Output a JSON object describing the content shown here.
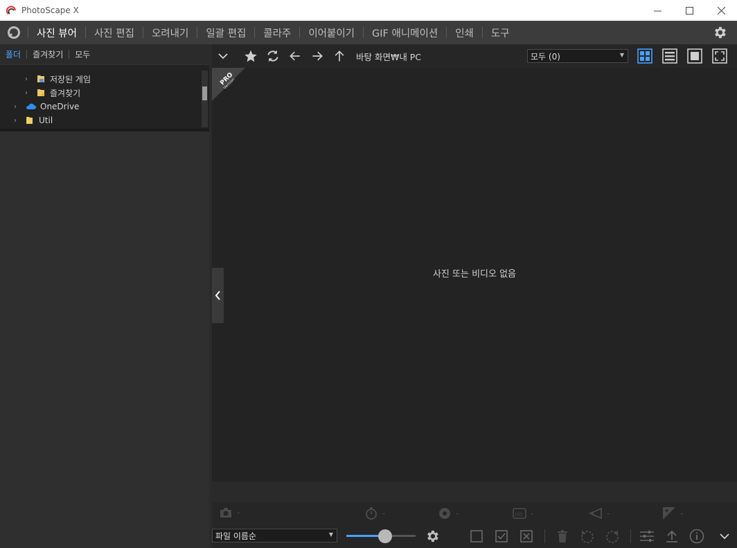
{
  "window": {
    "title": "PhotoScape X",
    "minimize_glyph": "—",
    "maximize_glyph": "☐",
    "close_glyph": "✕"
  },
  "menu": {
    "items": [
      {
        "label": "사진 뷰어",
        "active": true
      },
      {
        "label": "사진 편집",
        "active": false
      },
      {
        "label": "오려내기",
        "active": false
      },
      {
        "label": "일괄 편집",
        "active": false
      },
      {
        "label": "콜라주",
        "active": false
      },
      {
        "label": "이어붙이기",
        "active": false
      },
      {
        "label": "GIF 애니메이션",
        "active": false
      },
      {
        "label": "인쇄",
        "active": false
      },
      {
        "label": "도구",
        "active": false
      }
    ]
  },
  "left_tabs": {
    "folder": "폴더",
    "favorites": "즐겨찾기",
    "all": "모두"
  },
  "tree": {
    "items": [
      {
        "label": "저장된 게임",
        "icon": "saved-games-icon"
      },
      {
        "label": "즐겨찾기",
        "icon": "favorites-folder-icon"
      },
      {
        "label": "OneDrive",
        "icon": "onedrive-cloud-icon"
      },
      {
        "label": "Util",
        "icon": "folder-icon"
      }
    ]
  },
  "toolbar": {
    "path": "바탕 화면₩내 PC",
    "filter_value": "모두 (0)"
  },
  "viewer": {
    "empty_message": "사진 또는 비디오 없음",
    "badge_main": "PRO",
    "badge_sub": "Version"
  },
  "exif": {
    "camera": "-",
    "shutter": "-",
    "aperture": "-",
    "iso": "-",
    "focal": "-",
    "exposure": "-"
  },
  "bottom": {
    "sort_value": "파일 이름순",
    "thumbnail_size_fraction": 0.56
  },
  "colors": {
    "accent": "#4a9eff",
    "active_tab": "#4fa3ff",
    "background": "#232323"
  }
}
